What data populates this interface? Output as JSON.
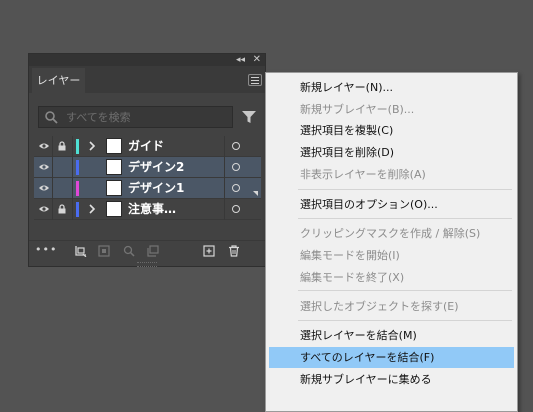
{
  "panel": {
    "tab_label": "レイヤー",
    "collapse_glyph": "◂◂",
    "close_glyph": "✕",
    "search_placeholder": "すべてを検索",
    "more_glyph": "•••",
    "layers": [
      {
        "name": "ガイド",
        "color": "#4fe0d4",
        "locked": true,
        "expandable": true,
        "selected": false
      },
      {
        "name": "デザイン2",
        "color": "#4a6cf0",
        "locked": false,
        "expandable": false,
        "selected": true
      },
      {
        "name": "デザイン1",
        "color": "#e048d8",
        "locked": false,
        "expandable": false,
        "selected": true
      },
      {
        "name": "注意事…",
        "color": "#4a6cf0",
        "locked": true,
        "expandable": true,
        "selected": false
      }
    ],
    "bottom_icons": [
      "collect-export-icon",
      "make-clipping-mask-icon",
      "locate-object-icon",
      "new-sublayer-icon",
      "new-layer-icon",
      "delete-icon"
    ]
  },
  "menu": {
    "items": [
      {
        "label": "新規レイヤー(N)...",
        "enabled": true
      },
      {
        "label": "新規サブレイヤー(B)...",
        "enabled": false
      },
      {
        "label": "選択項目を複製(C)",
        "enabled": true
      },
      {
        "label": "選択項目を削除(D)",
        "enabled": true
      },
      {
        "label": "非表示レイヤーを削除(A)",
        "enabled": false
      },
      {
        "label": "選択項目のオプション(O)...",
        "enabled": true
      },
      {
        "label": "クリッピングマスクを作成 / 解除(S)",
        "enabled": false
      },
      {
        "label": "編集モードを開始(I)",
        "enabled": false
      },
      {
        "label": "編集モードを終了(X)",
        "enabled": false
      },
      {
        "label": "選択したオブジェクトを探す(E)",
        "enabled": false
      },
      {
        "label": "選択レイヤーを結合(M)",
        "enabled": true
      },
      {
        "label": "すべてのレイヤーを結合(F)",
        "enabled": true,
        "highlighted": true
      },
      {
        "label": "新規サブレイヤーに集める",
        "enabled": true
      }
    ]
  },
  "colors": {
    "background": "#535353",
    "panel": "#424242",
    "selected_row": "#4b5766",
    "menu_highlight": "#91c9f7"
  }
}
